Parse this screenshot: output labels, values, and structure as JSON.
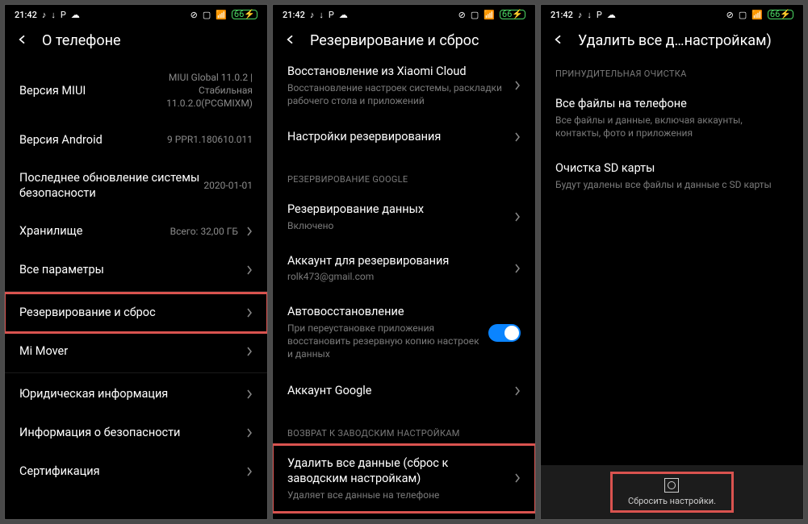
{
  "status": {
    "time": "21:42",
    "battery": "66",
    "icons": [
      "tiktok",
      "download",
      "p",
      "cloud"
    ],
    "right_icons": [
      "dnd",
      "cast",
      "data",
      "signal"
    ]
  },
  "screen1": {
    "title": "О телефоне",
    "miui_label": "Версия MIUI",
    "miui_value": "MIUI Global 11.0.2 | Стабильная 11.0.2.0(PCGMIXM)",
    "android_label": "Версия Android",
    "android_value": "9 PPR1.180610.011",
    "patch_label": "Последнее обновление системы безопасности",
    "patch_value": "2020-01-01",
    "storage_label": "Хранилище",
    "storage_value": "Всего: 32,00 ГБ",
    "all_specs": "Все параметры",
    "backup_reset": "Резервирование и сброс",
    "mi_mover": "Mi Mover",
    "legal": "Юридическая информация",
    "security_info": "Информация о безопасности",
    "cert": "Сертификация"
  },
  "screen2": {
    "title": "Резервирование и сброс",
    "xiaomi_restore_label": "Восстановление из Xiaomi Cloud",
    "xiaomi_restore_sub": "Восстановление настроек системы, раскладки рабочего стола и приложений",
    "backup_settings": "Настройки резервирования",
    "google_header": "РЕЗЕРВИРОВАНИЕ GOOGLE",
    "data_backup_label": "Резервирование данных",
    "data_backup_sub": "Включено",
    "account_label": "Аккаунт для резервирования",
    "account_sub": "rolk473@gmail.com",
    "auto_restore_label": "Автовосстановление",
    "auto_restore_sub": "При переустановке приложения восстановить резервную копию настроек и данных",
    "google_account": "Аккаунт Google",
    "factory_header": "ВОЗВРАТ К ЗАВОДСКИМ НАСТРОЙКАМ",
    "factory_reset_label": "Удалить все данные (сброс к заводским настройкам)",
    "factory_reset_sub": "Удаляет все данные на телефоне"
  },
  "screen3": {
    "title": "Удалить все д…настройкам)",
    "force_header": "ПРИНУДИТЕЛЬНАЯ ОЧИСТКА",
    "all_files_label": "Все файлы на телефоне",
    "all_files_sub": "Все файлы и данные, включая аккаунты, контакты, фото и приложения",
    "sd_label": "Очистка SD карты",
    "sd_sub": "Будут удалены все файлы и данные с SD карты",
    "reset_button": "Сбросить настройки."
  }
}
